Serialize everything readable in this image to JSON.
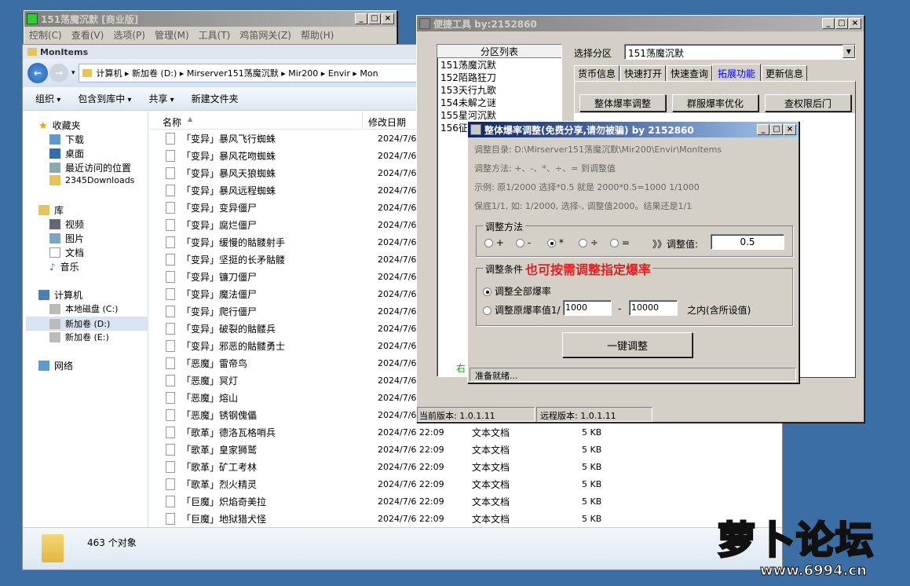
{
  "main_app": {
    "title": "151荡魔沉默 [商业版]",
    "menu": [
      "控制(C)",
      "查看(V)",
      "选项(P)",
      "管理(M)",
      "工具(T)",
      "鸡笛网关(Z)",
      "帮助(H)"
    ]
  },
  "explorer": {
    "title": "MonItems",
    "address": [
      "计算机",
      "新加卷 (D:)",
      "Mirserver151荡魔沉默",
      "Mir200",
      "Envir",
      "Mon"
    ],
    "toolbar": [
      "组织",
      "包含到库中",
      "共享",
      "新建文件夹"
    ],
    "columns": {
      "name": "名称",
      "date": "修改日期"
    },
    "nav": {
      "favorites": "收藏夹",
      "downloads": "下载",
      "desktop": "桌面",
      "recent": "最近访问的位置",
      "d2345": "2345Downloads",
      "libraries": "库",
      "videos": "视频",
      "pictures": "图片",
      "documents": "文档",
      "music": "音乐",
      "computer": "计算机",
      "local_c": "本地磁盘 (C:)",
      "new_d": "新加卷 (D:)",
      "new_e": "新加卷 (E:)",
      "network": "网络"
    },
    "files": [
      {
        "name": "「变异」暴风飞行蜘蛛",
        "date": "2024/7/6 2"
      },
      {
        "name": "「变异」暴风花吻蜘蛛",
        "date": "2024/7/6 2"
      },
      {
        "name": "「变异」暴风天狼蜘蛛",
        "date": "2024/7/6 2"
      },
      {
        "name": "「变异」暴风远程蜘蛛",
        "date": "2024/7/6 2"
      },
      {
        "name": "「变异」变异僵尸",
        "date": "2024/7/6 2"
      },
      {
        "name": "「变异」腐烂僵尸",
        "date": "2024/7/6 2"
      },
      {
        "name": "「变异」缓慢的骷髅射手",
        "date": "2024/7/6 2"
      },
      {
        "name": "「变异」坚挺的长矛骷髅",
        "date": "2024/7/6 2"
      },
      {
        "name": "「变异」镰刀僵尸",
        "date": "2024/7/6 2"
      },
      {
        "name": "「变异」魔法僵尸",
        "date": "2024/7/6 2"
      },
      {
        "name": "「变异」爬行僵尸",
        "date": "2024/7/6 2"
      },
      {
        "name": "「变异」破裂的骷髅兵",
        "date": "2024/7/6 2"
      },
      {
        "name": "「变异」邪恶的骷髅勇士",
        "date": "2024/7/6 2"
      },
      {
        "name": "「恶魔」雷帝鸟",
        "date": "2024/7/6 2"
      },
      {
        "name": "「恶魔」冥灯",
        "date": "2024/7/6 2"
      },
      {
        "name": "「恶魔」熔山",
        "date": "2024/7/6 2"
      },
      {
        "name": "「恶魔」锈钢傀儡",
        "date": "2024/7/6 2"
      },
      {
        "name": "「歌革」德洛瓦格哨兵",
        "date": "2024/7/6 22:09",
        "type": "文本文档",
        "size": "5 KB"
      },
      {
        "name": "「歌革」皇家狮鹫",
        "date": "2024/7/6 22:09",
        "type": "文本文档",
        "size": "5 KB"
      },
      {
        "name": "「歌革」矿工考林",
        "date": "2024/7/6 22:09",
        "type": "文本文档",
        "size": "5 KB"
      },
      {
        "name": "「歌革」烈火精灵",
        "date": "2024/7/6 22:09",
        "type": "文本文档",
        "size": "5 KB"
      },
      {
        "name": "「巨魔」炽焰奇美拉",
        "date": "2024/7/6 22:09",
        "type": "文本文档",
        "size": "5 KB"
      },
      {
        "name": "「巨魔」地狱猎犬怪",
        "date": "2024/7/6 22:09",
        "type": "文本文档",
        "size": "5 KB"
      }
    ],
    "status": "463 个对象"
  },
  "tool": {
    "title": "便捷工具  by:2152860",
    "list_header": "分区列表",
    "partitions": [
      "151荡魔沉默",
      "152陌路狂刀",
      "153天行九歌",
      "154未解之谜",
      "155星河沉默",
      "156征"
    ],
    "list_footer": "右",
    "select_label": "选择分区",
    "select_value": "151荡魔沉默",
    "tabs": [
      "货币信息",
      "快速打开",
      "快速查询",
      "拓展功能",
      "更新信息"
    ],
    "buttons": [
      "整体爆率调整",
      "群服爆率优化",
      "查权限后门"
    ],
    "current_version": "当前版本: 1.0.1.11",
    "remote_version": "远程版本: 1.0.1.11"
  },
  "dialog": {
    "title": "整体爆率调整(免费分享,请勿被骗)   by 2152860",
    "dir_line": "调整目录: D:\\Mirserver151荡魔沉默\\Mir200\\Envir\\MonItems",
    "method_line": "调整方法: +、-、*、÷、=  到调整值",
    "example_line": "示例: 原1/2000 选择*0.5 就是 2000*0.5=1000  1/1000",
    "floor_line": "保底1/1, 如: 1/2000, 选择-, 调整值2000。结果还是1/1",
    "group_method": "调整方法",
    "ops": [
      "+",
      "-",
      "*",
      "÷",
      "="
    ],
    "value_label": "》》调整值:",
    "value": "0.5",
    "group_cond": "调整条件",
    "annotation": "也可按需调整指定爆率",
    "opt_all": "调整全部爆率",
    "opt_range": "调整原爆率值1/",
    "range_from": "1000",
    "dash": "-",
    "range_to": "10000",
    "range_suffix": "之内(含所设值)",
    "run_button": "一键调整",
    "status": "准备就绪..."
  },
  "watermark": {
    "text": "萝卜论坛",
    "url": "www.6994.cn"
  }
}
